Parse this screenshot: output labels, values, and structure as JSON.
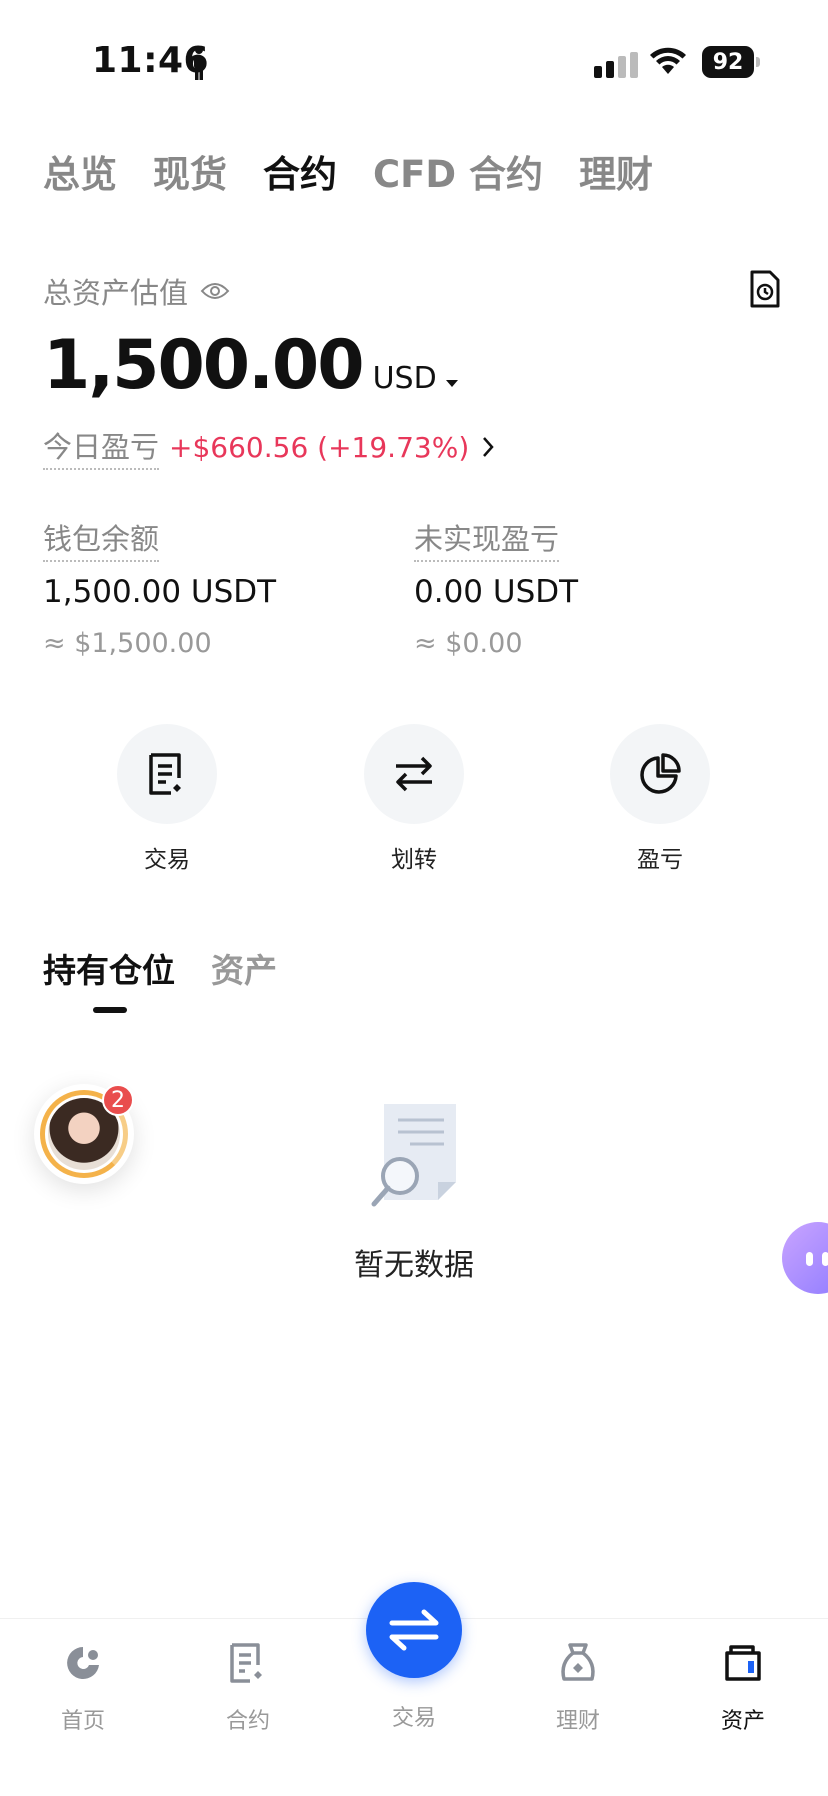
{
  "status_bar": {
    "time": "11:46",
    "battery": "92"
  },
  "top_tabs": [
    {
      "label": "总览",
      "active": false
    },
    {
      "label": "现货",
      "active": false
    },
    {
      "label": "合约",
      "active": true
    },
    {
      "label": "CFD 合约",
      "active": false
    },
    {
      "label": "理财",
      "active": false
    }
  ],
  "asset": {
    "label": "总资产估值",
    "total_value": "1,500.00",
    "currency": "USD",
    "pnl_label": "今日盈亏",
    "pnl_value": "+$660.56 (+19.73%)"
  },
  "balances": {
    "wallet": {
      "label": "钱包余额",
      "value": "1,500.00 USDT",
      "approx": "≈ $1,500.00"
    },
    "unrealized": {
      "label": "未实现盈亏",
      "value": "0.00 USDT",
      "approx": "≈ $0.00"
    }
  },
  "actions": [
    {
      "label": "交易",
      "icon": "trade-doc-icon"
    },
    {
      "label": "划转",
      "icon": "transfer-arrows-icon"
    },
    {
      "label": "盈亏",
      "icon": "pie-chart-icon"
    }
  ],
  "sub_tabs": [
    {
      "label": "持有仓位",
      "active": true
    },
    {
      "label": "资产",
      "active": false
    }
  ],
  "empty_state": {
    "text": "暂无数据"
  },
  "float_avatar": {
    "badge": "2"
  },
  "bottom_nav": [
    {
      "label": "首页",
      "icon": "home-icon",
      "active": false
    },
    {
      "label": "合约",
      "icon": "contract-icon",
      "active": false
    },
    {
      "label": "交易",
      "icon": "swap-icon",
      "active": false
    },
    {
      "label": "理财",
      "icon": "finance-icon",
      "active": false
    },
    {
      "label": "资产",
      "icon": "wallet-icon",
      "active": true
    }
  ],
  "colors": {
    "accent": "#1c62f5",
    "profit": "#e8375a",
    "muted": "#888888"
  }
}
